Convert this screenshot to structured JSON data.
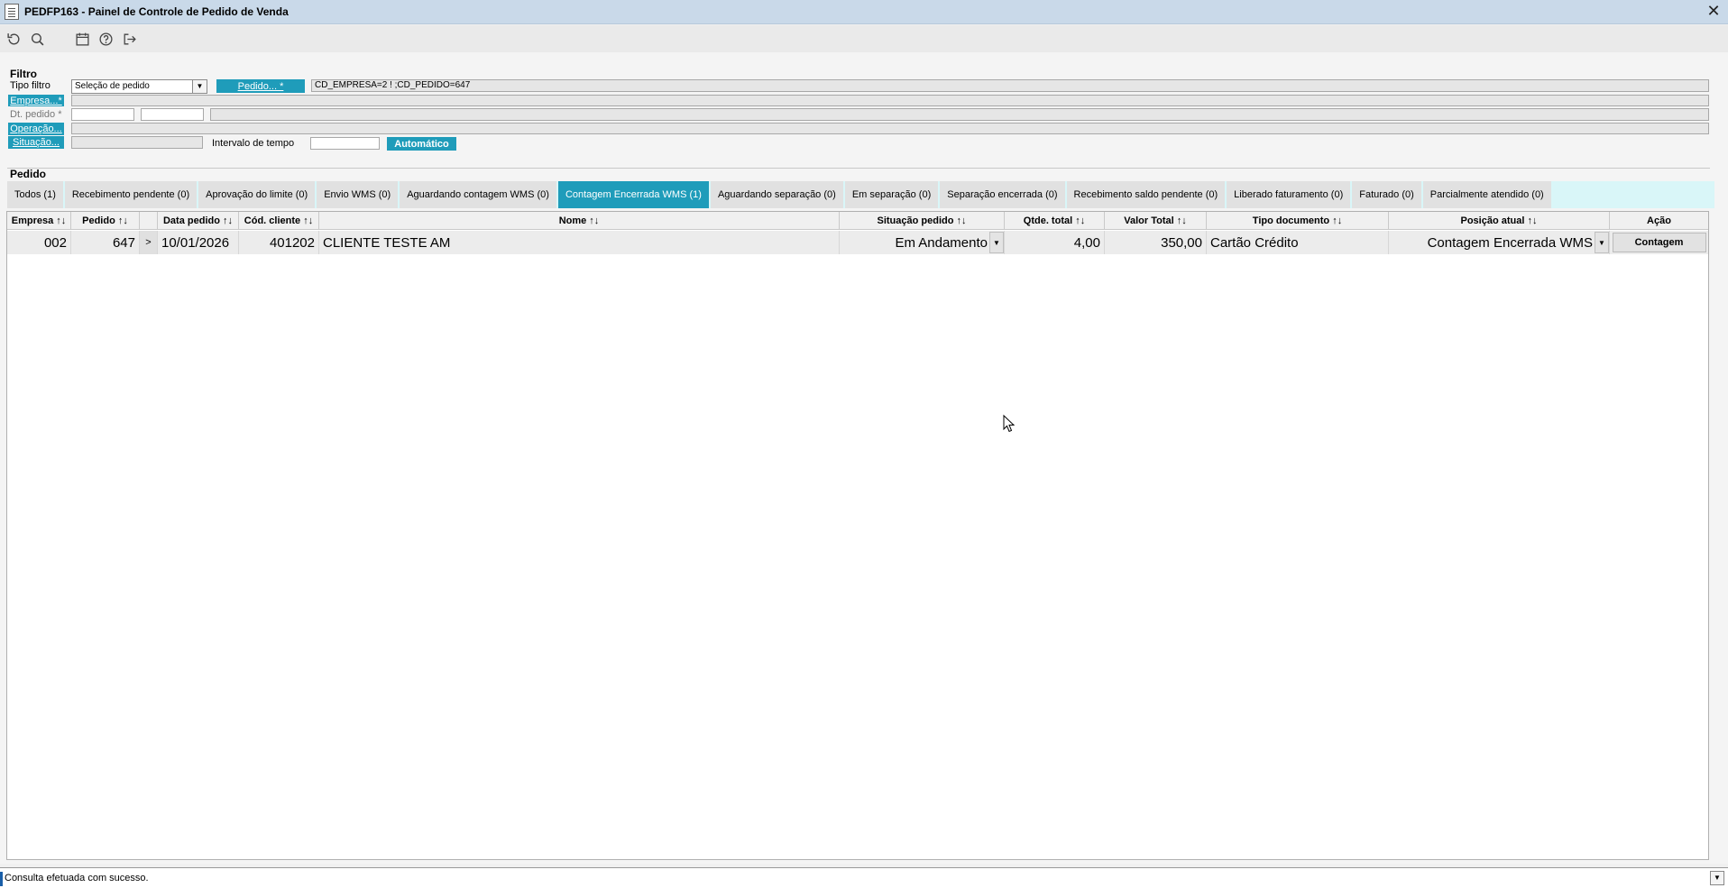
{
  "window": {
    "title": "PEDFP163 - Painel de Controle de Pedido de Venda"
  },
  "toolbar": {
    "icons": [
      "refresh-icon",
      "search-icon",
      "calendar-icon",
      "help-icon",
      "exit-icon"
    ]
  },
  "filter": {
    "section_title": "Filtro",
    "tipo_filtro_label": "Tipo filtro",
    "tipo_filtro_value": "Seleção de pedido",
    "pedido_button": "Pedido... *",
    "pedido_value": "CD_EMPRESA=2 ! ;CD_PEDIDO=647",
    "empresa_button": "Empresa...*",
    "dt_pedido_label": "Dt. pedido *",
    "operacao_button": "Operação...",
    "situacao_button": "Situação...",
    "intervalo_label": "Intervalo de tempo",
    "automatico_button": "Automático"
  },
  "pedido": {
    "section_title": "Pedido",
    "tabs": [
      "Todos (1)",
      "Recebimento pendente (0)",
      "Aprovação do limite (0)",
      "Envio WMS (0)",
      "Aguardando contagem WMS (0)",
      "Contagem Encerrada WMS (1)",
      "Aguardando separação (0)",
      "Em separação (0)",
      "Separação encerrada (0)",
      "Recebimento saldo pendente (0)",
      "Liberado faturamento (0)",
      "Faturado (0)",
      "Parcialmente atendido (0)"
    ],
    "active_tab": "Contagem Encerrada WMS (1)"
  },
  "grid": {
    "headers": {
      "empresa": "Empresa ↑↓",
      "pedido": "Pedido ↑↓",
      "data_pedido": "Data pedido ↑↓",
      "cod_cliente": "Cód. cliente ↑↓",
      "nome": "Nome ↑↓",
      "situacao": "Situação pedido ↑↓",
      "qtde": "Qtde. total ↑↓",
      "valor": "Valor Total ↑↓",
      "tipo_doc": "Tipo documento ↑↓",
      "posicao": "Posição atual ↑↓",
      "acao": "Ação"
    },
    "row": {
      "empresa": "002",
      "pedido": "647",
      "expander": ">",
      "data_pedido": "10/01/2026",
      "cod_cliente": "401202",
      "nome": "CLIENTE TESTE AM",
      "situacao": "Em Andamento",
      "qtde": "4,00",
      "valor": "350,00",
      "tipo_doc": "Cartão Crédito",
      "posicao": "Contagem Encerrada WMS",
      "acao": "Contagem"
    }
  },
  "status": {
    "message": "Consulta efetuada com sucesso."
  },
  "colors": {
    "accent": "#1f9cba",
    "tab_strip": "#d9f6f8",
    "titlebar": "#c9d9e9"
  }
}
